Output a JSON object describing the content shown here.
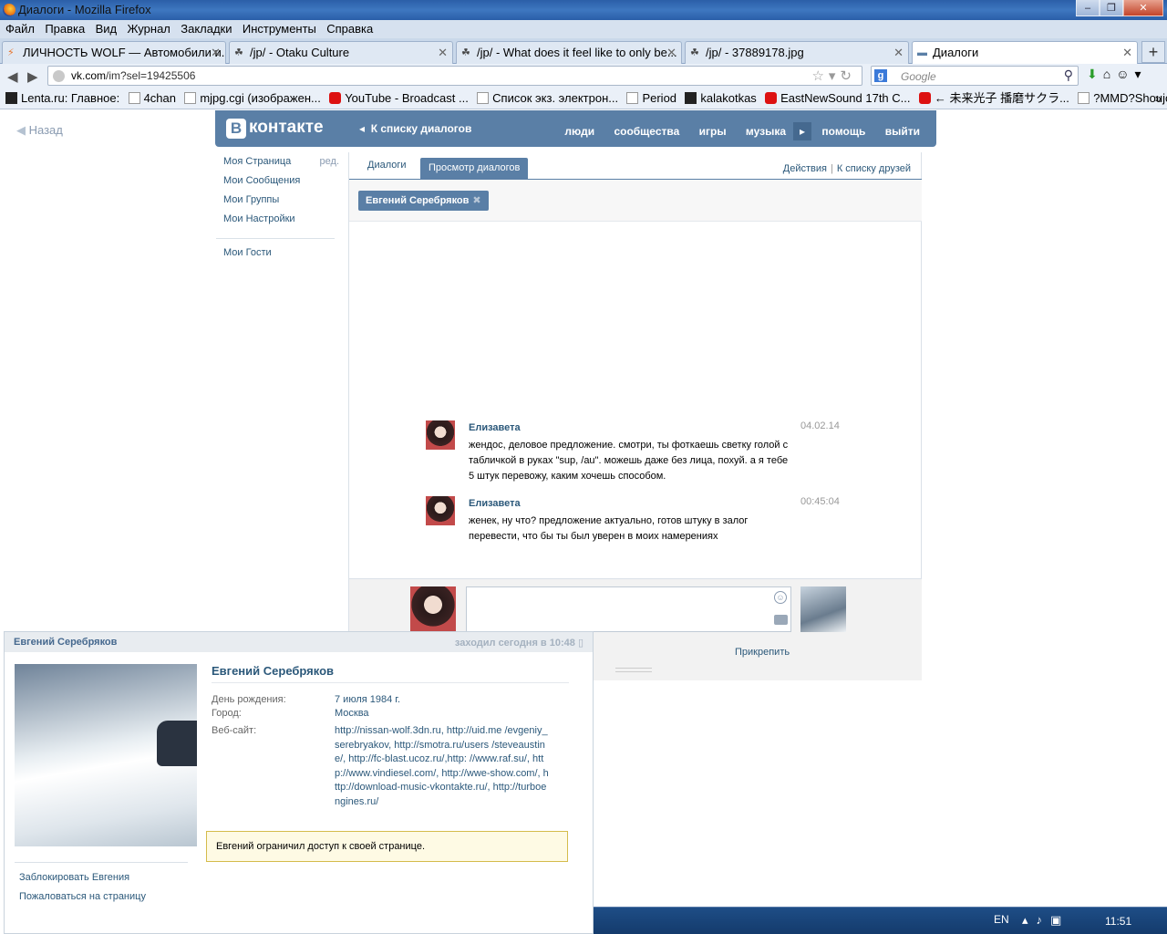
{
  "window": {
    "title": "Диалоги - Mozilla Firefox",
    "buttons": [
      "–",
      "❐",
      "✕"
    ]
  },
  "menu": [
    "Файл",
    "Правка",
    "Вид",
    "Журнал",
    "Закладки",
    "Инструменты",
    "Справка"
  ],
  "tabs": [
    {
      "label": "ЛИЧНОСТЬ WOLF — Автомобили и..."
    },
    {
      "label": "/jp/ - Otaku Culture"
    },
    {
      "label": "/jp/ - What does it feel like to only be..."
    },
    {
      "label": "/jp/ - 37889178.jpg"
    },
    {
      "label": "Диалоги"
    }
  ],
  "nav": {
    "url_domain": "vk.com",
    "url_path": "/im?sel=19425506",
    "search_placeholder": "Google"
  },
  "bookmarks": [
    "Lenta.ru: Главное:",
    "4chan",
    "mjpg.cgi (изображен...",
    "YouTube - Broadcast ...",
    "Список экз. электрон...",
    "Period",
    "kalakotkas",
    "EastNewSound 17th C...",
    "← 未来光子 播磨サクラ...",
    "?MMD?Shoujo Misui?..."
  ],
  "vk": {
    "back": "Назад",
    "logo": "контакте",
    "logo_letter": "В",
    "dialogs_link": "К списку диалогов",
    "top_nav": [
      "люди",
      "сообщества",
      "игры",
      "музыка",
      "помощь",
      "выйти"
    ],
    "left_menu": {
      "my_page": "Моя Страница",
      "edit": "ред.",
      "messages": "Мои Сообщения",
      "groups": "Мои Группы",
      "settings": "Мои Настройки",
      "guests": "Мои Гости"
    },
    "im_tabs": [
      "Диалоги",
      "Просмотр диалогов"
    ],
    "actions": "Действия",
    "friends_link": "К списку друзей",
    "peer_chip": "Евгений Серебряков",
    "messages": [
      {
        "author": "Елизавета",
        "date": "04.02.14",
        "text": "жендос, деловое предложение. смотри, ты фоткаешь светку голой с табличкой в руках \"sup, /au\". можешь даже без лица, похуй. а я тебе 5 штук перевожу, каким хочешь способом."
      },
      {
        "author": "Елизавета",
        "date": "00:45:04",
        "text": "женек, ну что? предложение актуально, готов штуку в залог перевести, что бы ты был уверен в моих намерениях"
      }
    ],
    "attach": "Прикрепить"
  },
  "profile": {
    "header_name": "Евгений Серебряков",
    "online": "заходил сегодня в 10:48",
    "name": "Евгений Серебряков",
    "birthday_label": "День рождения:",
    "birthday": "7 июля 1984 г.",
    "city_label": "Город:",
    "city": "Москва",
    "website_label": "Веб-сайт:",
    "website": "http://nissan-wolf.3dn.ru, http://uid.me /evgeniy_serebryakov, http://smotra.ru/users /steveaustine/, http://fc-blast.ucoz.ru/,http: //www.raf.su/, http://www.vindiesel.com/, http://wwe-show.com/, http://download-music-vkontakte.ru/, http://turboengines.ru/",
    "restricted": "Евгений ограничил доступ к своей странице.",
    "block": "Заблокировать Евгения",
    "report": "Пожаловаться на страницу"
  },
  "taskbar": {
    "lang": "EN",
    "time": "11:51"
  },
  "colors": {
    "vk_blue": "#5a7fa6",
    "link": "#2b587a",
    "warning_bg": "#fefae4"
  }
}
